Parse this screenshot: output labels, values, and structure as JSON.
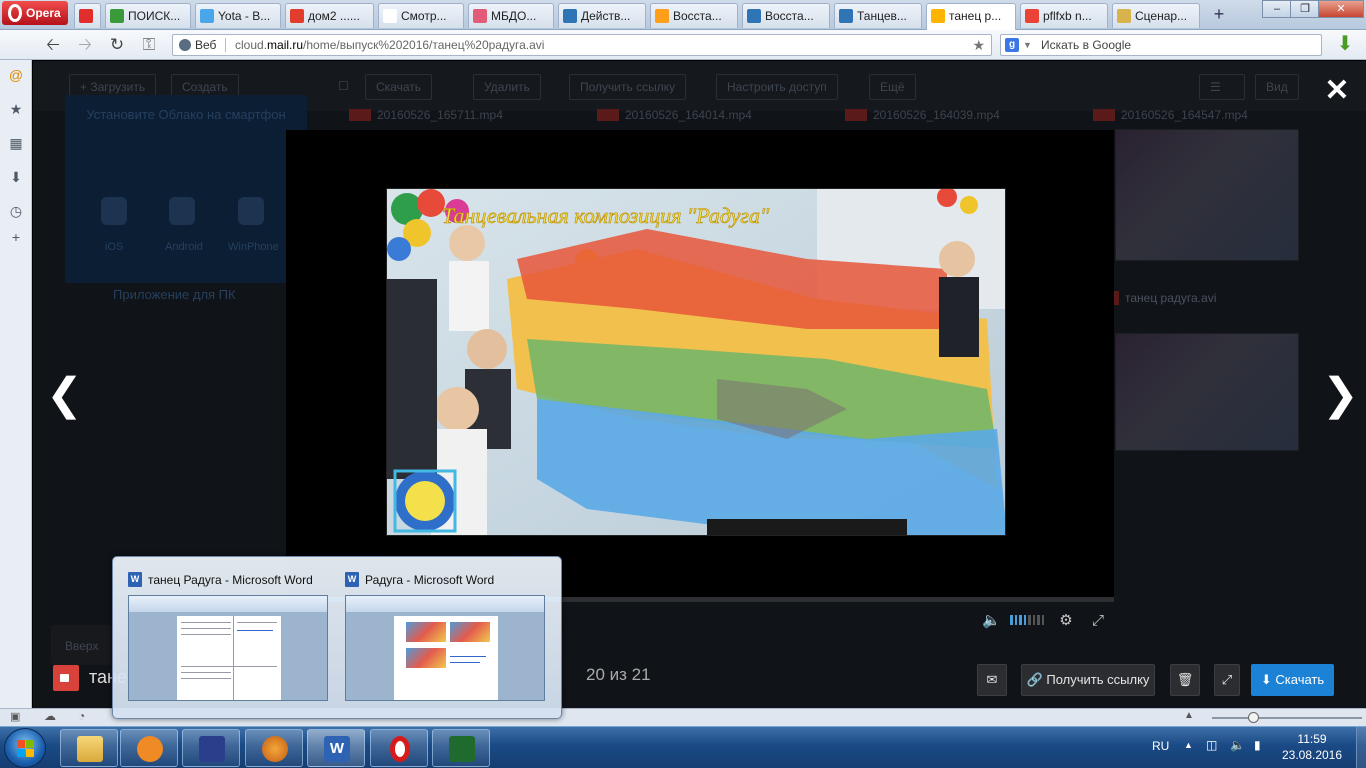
{
  "browser": {
    "menu_label": "Opera",
    "tabs": [
      {
        "title": "",
        "color": "#e22d2d"
      },
      {
        "title": "ПОИСК...",
        "color": "#3a9a3a"
      },
      {
        "title": "Yota - В...",
        "color": "#49a6e8"
      },
      {
        "title": "дом2 ......",
        "color": "#e23c2c"
      },
      {
        "title": "Смотр...",
        "color": "#ffffff"
      },
      {
        "title": "МБДО...",
        "color": "#e25c7a"
      },
      {
        "title": "Действ...",
        "color": "#2f74b5"
      },
      {
        "title": "Восста...",
        "color": "#ff9e1b"
      },
      {
        "title": "Восста...",
        "color": "#2f74b5"
      },
      {
        "title": "Танцев...",
        "color": "#2f74b5"
      },
      {
        "title": "танец р...",
        "color": "#ffb400"
      },
      {
        "title": "pflfxb n...",
        "color": "#ea4335"
      },
      {
        "title": "Сценар...",
        "color": "#d8b24a"
      }
    ],
    "url_prefix": "Веб",
    "url_before": "cloud.",
    "url_host": "mail.ru",
    "url_after": "/home/выпуск%202016/танец%20радуга.avi",
    "search_placeholder": "Искать в Google"
  },
  "cloud": {
    "toolbar": {
      "upload": "+ Загрузить",
      "create": "Создать",
      "download": "Скачать",
      "delete": "Удалить",
      "get_link": "Получить ссылку",
      "share": "Настроить доступ",
      "more": "Ещё",
      "view": "Вид"
    },
    "promo": {
      "title": "Установите Облако на смартфон",
      "ios": "iOS",
      "android": "Android",
      "winphone": "WinPhone",
      "pc": "Приложение для ПК"
    },
    "files": [
      "20160526_165711.mp4",
      "20160526_164014.mp4",
      "20160526_164039.mp4",
      "20160526_164547.mp4"
    ],
    "selected_file": "танец радуга.avi",
    "up_label": "Вверх"
  },
  "viewer": {
    "video_caption": "Танцевальная композиция \"Радуга\"",
    "progress": 0.33,
    "volume_bars_on": 4,
    "volume_bars_total": 8,
    "file_title": "танец радуга.avi",
    "counter": "20 из 21",
    "get_link": "Получить ссылку",
    "download": "Скачать"
  },
  "thumbnail_popup": {
    "windows": [
      {
        "title": "танец Радуга - Microsoft Word"
      },
      {
        "title": "Радуга - Microsoft Word"
      }
    ]
  },
  "tray": {
    "lang": "RU",
    "time": "11:59",
    "date": "23.08.2016"
  }
}
